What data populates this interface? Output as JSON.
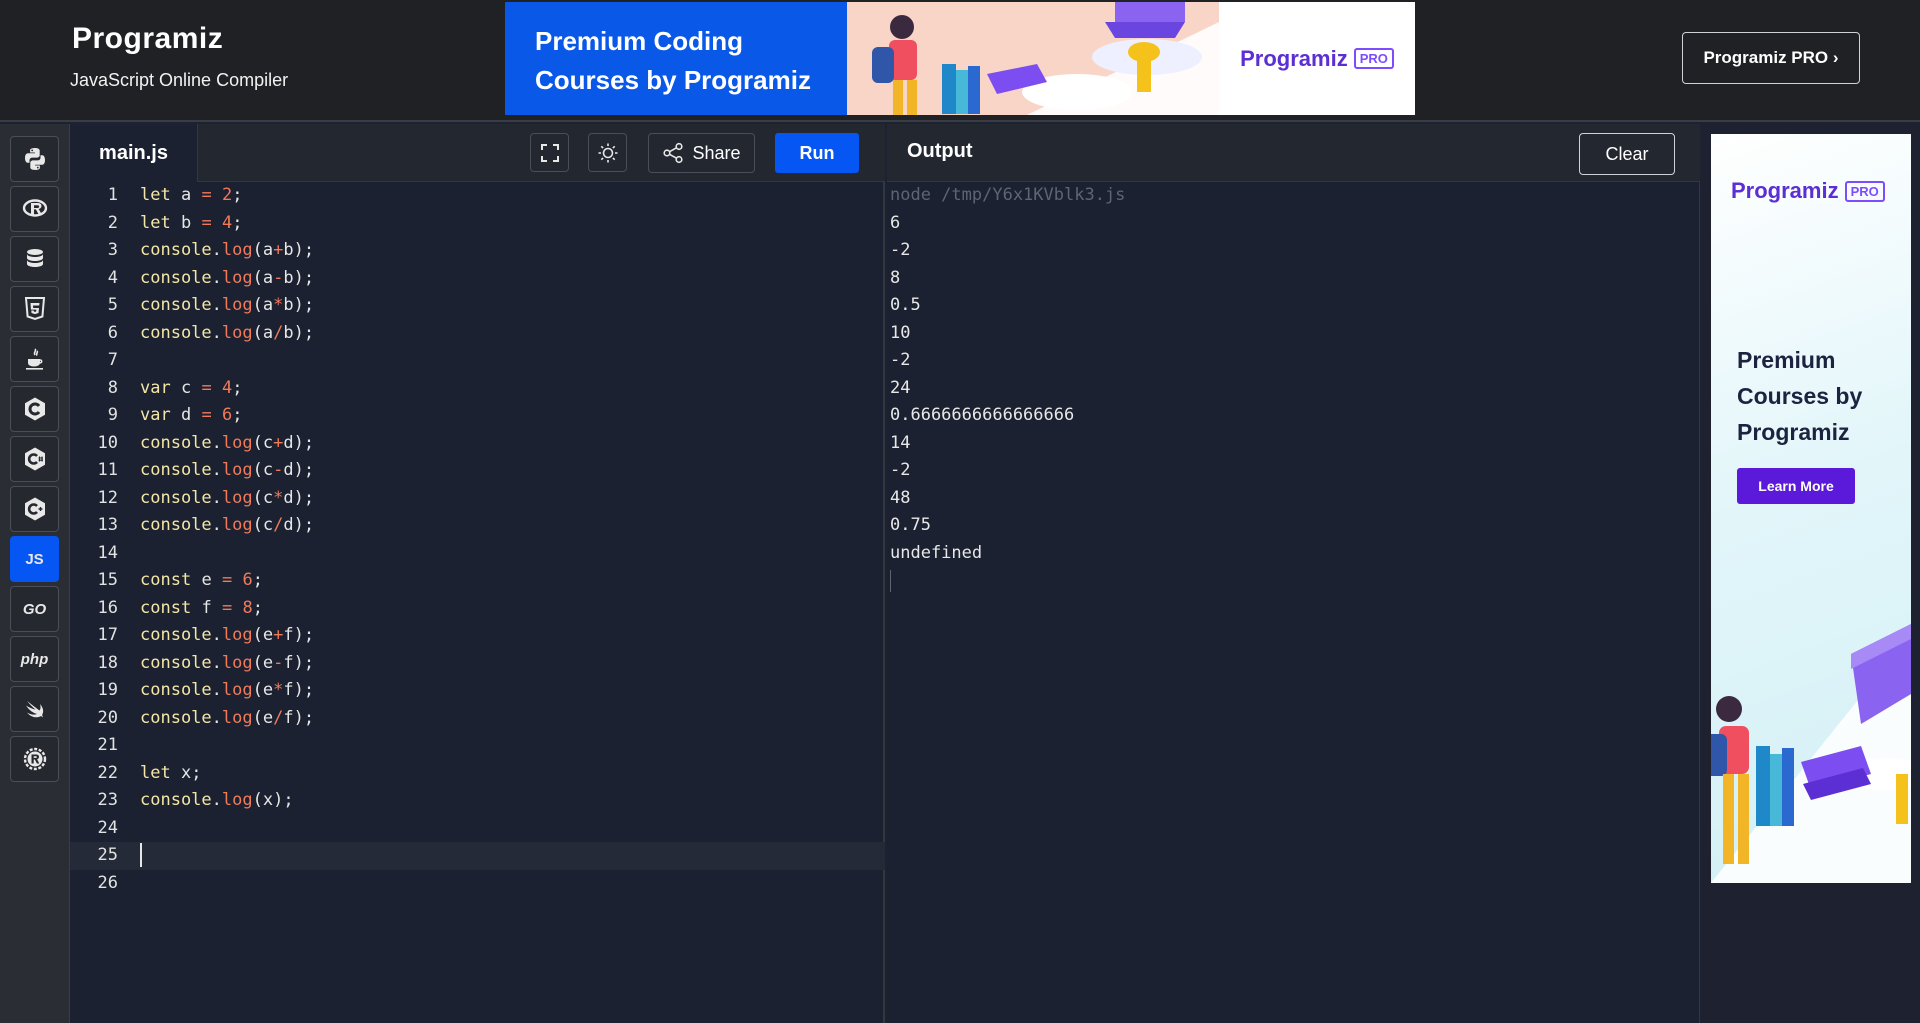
{
  "header": {
    "logo": "Programiz",
    "subtitle": "JavaScript Online Compiler",
    "pro_button": "Programiz PRO ›"
  },
  "banner": {
    "line1": "Premium Coding",
    "line2": "Courses by Programiz",
    "brand": "Programiz",
    "badge": "PRO"
  },
  "languages": [
    {
      "name": "python-icon"
    },
    {
      "name": "r-icon"
    },
    {
      "name": "sql-icon"
    },
    {
      "name": "html5-icon"
    },
    {
      "name": "java-icon"
    },
    {
      "name": "c-icon"
    },
    {
      "name": "csharp-icon"
    },
    {
      "name": "cpp-icon"
    },
    {
      "name": "javascript-icon",
      "label": "JS",
      "active": true
    },
    {
      "name": "go-icon",
      "label": "GO"
    },
    {
      "name": "php-icon",
      "label": "php"
    },
    {
      "name": "swift-icon"
    },
    {
      "name": "rust-icon"
    }
  ],
  "editor": {
    "filename": "main.js",
    "share_label": "Share",
    "run_label": "Run",
    "current_line": 25,
    "lines": [
      "let a = 2;",
      "let b = 4;",
      "console.log(a+b);",
      "console.log(a-b);",
      "console.log(a*b);",
      "console.log(a/b);",
      "",
      "var c = 4;",
      "var d = 6;",
      "console.log(c+d);",
      "console.log(c-d);",
      "console.log(c*d);",
      "console.log(c/d);",
      "",
      "const e = 6;",
      "const f = 8;",
      "console.log(e+f);",
      "console.log(e-f);",
      "console.log(e*f);",
      "console.log(e/f);",
      "",
      "let x;",
      "console.log(x);",
      "",
      "",
      ""
    ]
  },
  "output": {
    "title": "Output",
    "clear_label": "Clear",
    "command": "node /tmp/Y6x1KVblk3.js",
    "lines": [
      "6",
      "-2",
      "8",
      "0.5",
      "10",
      "-2",
      "24",
      "0.6666666666666666",
      "14",
      "-2",
      "48",
      "0.75",
      "undefined"
    ]
  },
  "ad": {
    "brand": "Programiz",
    "badge": "PRO",
    "headline_1": "Premium",
    "headline_2": "Courses by",
    "headline_3": "Programiz",
    "cta": "Learn More"
  },
  "colors": {
    "accent": "#0556f3",
    "editor_bg": "#1b2130",
    "header_bg": "#1f2124",
    "pro_purple": "#5b2fd4"
  }
}
